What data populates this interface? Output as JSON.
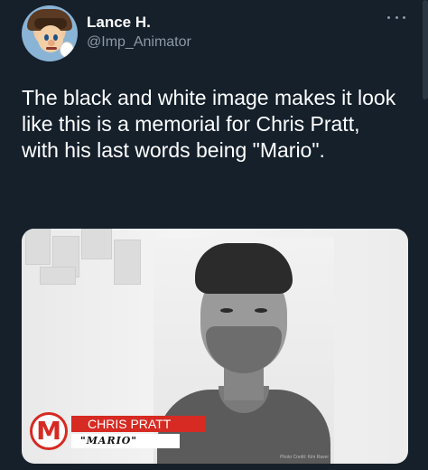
{
  "author": {
    "display_name": "Lance H.",
    "handle": "@Imp_Animator",
    "avatar_icon": "mario-avatar-icon"
  },
  "menu_icon": "more-options-icon",
  "tweet": {
    "text": "The black and white image makes it look like this is a memorial for Chris Pratt, with his last words being \"Mario\"."
  },
  "media": {
    "caption_name": "CHRIS PRATT",
    "caption_quote": "\"MARIO\"",
    "logo_letter": "M",
    "photo_credit": "Photo Credit: Kim Raver"
  },
  "colors": {
    "background": "#15202b",
    "accent_red": "#d62a22",
    "secondary_text": "#8b98a5"
  }
}
